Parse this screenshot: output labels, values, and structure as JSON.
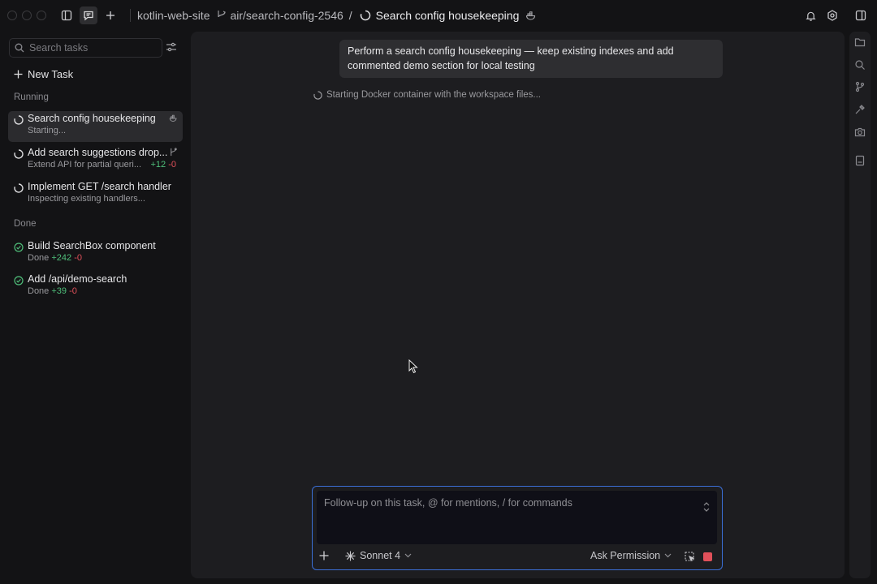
{
  "titlebar": {
    "project": "kotlin-web-site",
    "branch": "air/search-config-2546",
    "separator": "/",
    "task_title": "Search config housekeeping"
  },
  "sidebar": {
    "search_placeholder": "Search tasks",
    "new_task_label": "New Task",
    "running_label": "Running",
    "done_label": "Done",
    "running_tasks": [
      {
        "title": "Search config housekeeping",
        "subtitle": "Starting..."
      },
      {
        "title": "Add search suggestions drop...",
        "subtitle": "Extend API for partial queri...",
        "added": "+12",
        "removed": "-0"
      },
      {
        "title": "Implement GET /search handler",
        "subtitle": "Inspecting existing handlers..."
      }
    ],
    "done_tasks": [
      {
        "title": "Build SearchBox component",
        "subtitle": "Done",
        "added": "+242",
        "removed": "-0"
      },
      {
        "title": "Add /api/demo-search",
        "subtitle": "Done",
        "added": "+39",
        "removed": "-0"
      }
    ]
  },
  "main": {
    "user_message": "Perform a search config housekeeping — keep existing indexes and add commented demo section for local testing",
    "status": "Starting Docker container with the workspace files..."
  },
  "composer": {
    "placeholder": "Follow-up on this task, @ for mentions, / for commands",
    "model": "Sonnet 4",
    "permission": "Ask Permission"
  },
  "colors": {
    "accent": "#3b6fd6",
    "added": "#4fbf7a",
    "removed": "#e0505a",
    "stop": "#e0505a"
  },
  "icons": [
    "sidebar-toggle-icon",
    "chat-icon",
    "plus-icon",
    "branch-icon",
    "spinner-icon",
    "docker-icon",
    "bell-icon",
    "settings-icon",
    "panel-icon",
    "search-icon",
    "filter-icon",
    "check-circle-icon",
    "folder-icon",
    "git-icon",
    "tools-icon",
    "camera-icon",
    "document-icon",
    "sparkle-icon",
    "chevron-down-icon",
    "stop-icon"
  ]
}
